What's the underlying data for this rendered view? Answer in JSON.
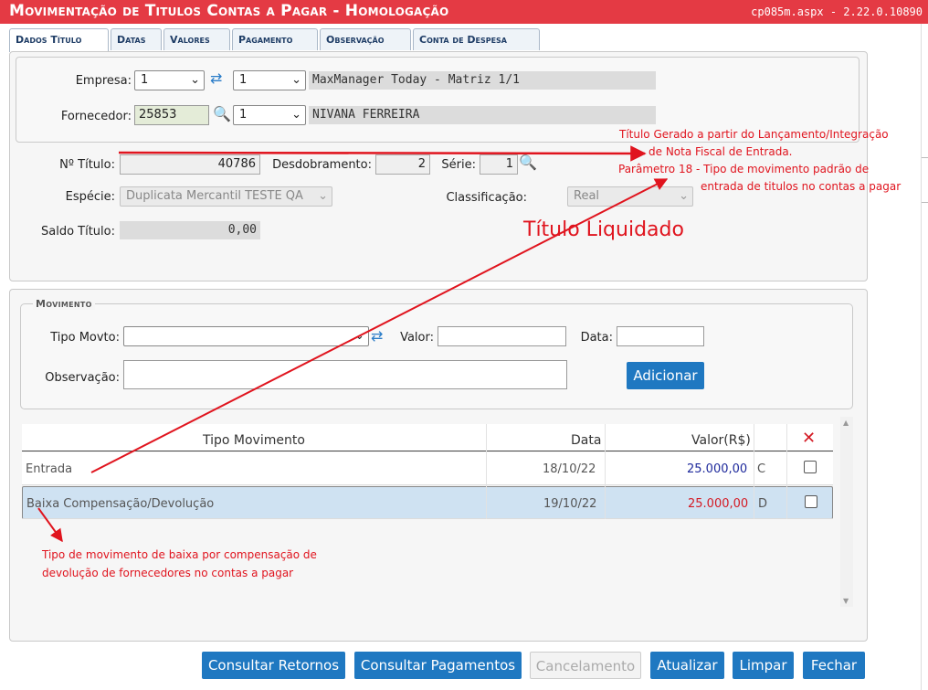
{
  "window": {
    "title": "Movimentação de Titulos Contas a Pagar - Homologação",
    "version": "cp085m.aspx - 2.22.0.10890"
  },
  "tabs": [
    {
      "label": "Dados Título",
      "active": true
    },
    {
      "label": "Datas"
    },
    {
      "label": "Valores"
    },
    {
      "label": "Pagamento"
    },
    {
      "label": "Observação"
    },
    {
      "label": "Conta de Despesa"
    }
  ],
  "empresa": {
    "label": "Empresa:",
    "code": "1",
    "sub": "1",
    "name": "MaxManager Today - Matriz 1/1"
  },
  "fornecedor": {
    "label": "Fornecedor:",
    "code": "25853",
    "sub": "1",
    "name": "NIVANA FERREIRA"
  },
  "titulo": {
    "numero_label": "Nº Título:",
    "numero": "40786",
    "desdobramento_label": "Desdobramento:",
    "desdobramento": "2",
    "serie_label": "Série:",
    "serie": "1",
    "especie_label": "Espécie:",
    "especie": "Duplicata Mercantil TESTE QA",
    "classificacao_label": "Classificação:",
    "classificacao": "Real",
    "saldo_label": "Saldo Título:",
    "saldo": "0,00"
  },
  "movimento": {
    "legend": "Movimento",
    "tipo_label": "Tipo Movto:",
    "tipo_value": "",
    "valor_label": "Valor:",
    "valor_value": "",
    "data_label": "Data:",
    "data_value": "",
    "obs_label": "Observação:",
    "add_label": "Adicionar"
  },
  "grid": {
    "columns": [
      "Tipo Movimento",
      "Data",
      "Valor(R$)",
      "",
      "✕"
    ],
    "rows": [
      {
        "tipo": "Entrada",
        "data": "18/10/22",
        "valor": "25.000,00",
        "dc": "C",
        "color": "#1f2a9c"
      },
      {
        "tipo": "Baixa Compensação/Devolução",
        "data": "19/10/22",
        "valor": "25.000,00",
        "dc": "D",
        "color": "#d41a24"
      }
    ]
  },
  "buttons": {
    "consultar_retornos": "Consultar Retornos",
    "consultar_pagamentos": "Consultar Pagamentos",
    "cancelamento": "Cancelamento",
    "atualizar": "Atualizar",
    "limpar": "Limpar",
    "fechar": "Fechar"
  },
  "annotations": {
    "a1_line1": "Título Gerado a partir do Lançamento/Integração",
    "a1_line2": "de Nota Fiscal de Entrada.",
    "a2_line1": "Parâmetro 18 - Tipo de movimento padrão de",
    "a2_line2": "entrada de titulos no contas a pagar",
    "liquidado": "Título Liquidado",
    "a3_line1": "Tipo de movimento de baixa por compensação de",
    "a3_line2": "devolução de fornecedores no contas a pagar"
  },
  "colors": {
    "titlebar": "#e43a44",
    "button": "#1f78c1",
    "annotation": "#e0141e",
    "icon": "#2a7cc8"
  }
}
